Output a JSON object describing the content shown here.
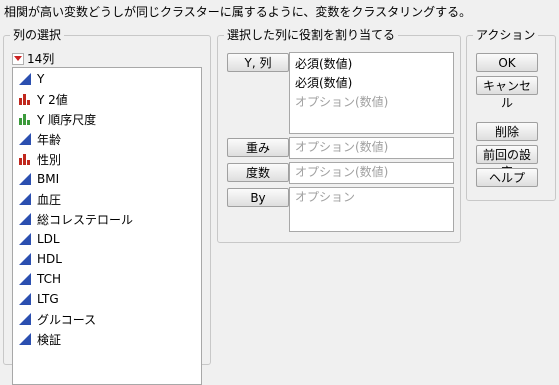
{
  "instruction": "相関が高い変数どうしが同じクラスターに属するように、変数をクラスタリングする。",
  "columns_panel": {
    "title": "列の選択",
    "count_label": "14列",
    "items": [
      {
        "label": "Y",
        "icon": "continuous-icon"
      },
      {
        "label": "Y 2値",
        "icon": "nominal-icon"
      },
      {
        "label": "Y 順序尺度",
        "icon": "ordinal-icon"
      },
      {
        "label": "年齢",
        "icon": "continuous-icon"
      },
      {
        "label": "性別",
        "icon": "nominal-icon"
      },
      {
        "label": "BMI",
        "icon": "continuous-icon"
      },
      {
        "label": "血圧",
        "icon": "continuous-icon"
      },
      {
        "label": "総コレステロール",
        "icon": "continuous-icon"
      },
      {
        "label": "LDL",
        "icon": "continuous-icon"
      },
      {
        "label": "HDL",
        "icon": "continuous-icon"
      },
      {
        "label": "TCH",
        "icon": "continuous-icon"
      },
      {
        "label": "LTG",
        "icon": "continuous-icon"
      },
      {
        "label": "グルコース",
        "icon": "continuous-icon"
      },
      {
        "label": "検証",
        "icon": "continuous-icon"
      }
    ]
  },
  "roles_panel": {
    "title": "選択した列に役割を割り当てる",
    "y_button": "Y, 列",
    "y_values": [
      "必須(数値)",
      "必須(数値)"
    ],
    "y_placeholder": "オプション(数値)",
    "weight_button": "重み",
    "weight_placeholder": "オプション(数値)",
    "freq_button": "度数",
    "freq_placeholder": "オプション(数値)",
    "by_button": "By",
    "by_placeholder": "オプション"
  },
  "action_panel": {
    "title": "アクション",
    "ok": "OK",
    "cancel": "キャンセル",
    "remove": "削除",
    "recall": "前回の設定",
    "help": "ヘルプ"
  },
  "colors": {
    "continuous": "#2b4fb0",
    "nominal": "#c0281e",
    "ordinal": "#3b9a3b",
    "red_triangle": "#cc2222"
  }
}
